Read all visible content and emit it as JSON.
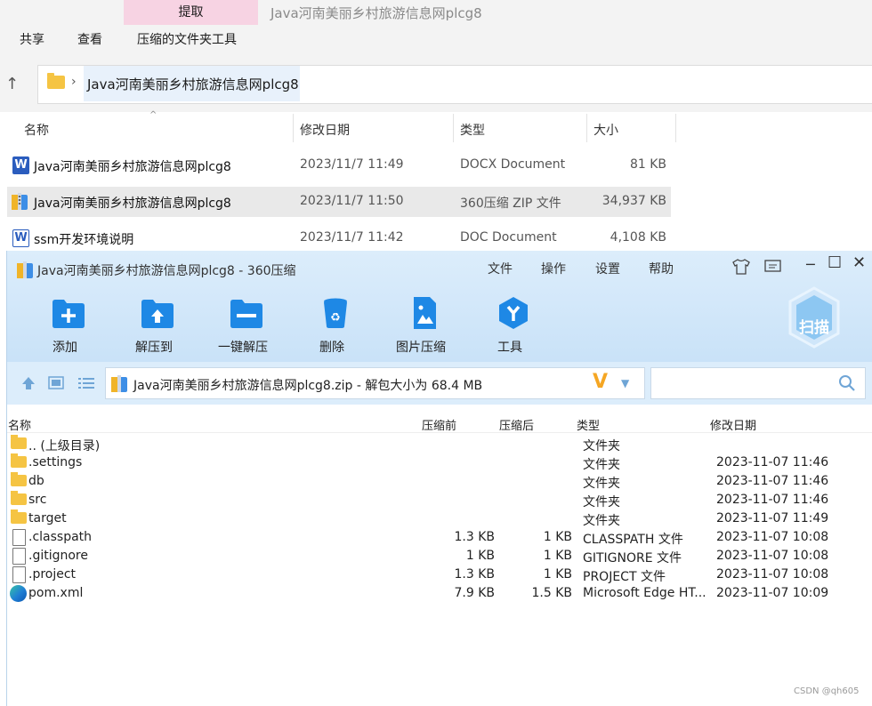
{
  "explorer": {
    "window_title": "Java河南美丽乡村旅游信息网plcg8",
    "ribbon": {
      "contextual_tab": "提取",
      "tabs": [
        "共享",
        "查看",
        "压缩的文件夹工具"
      ]
    },
    "address": {
      "crumb": "Java河南美丽乡村旅游信息网plcg8"
    },
    "columns": [
      "名称",
      "修改日期",
      "类型",
      "大小"
    ],
    "files": [
      {
        "name": "Java河南美丽乡村旅游信息网plcg8",
        "date": "2023/11/7 11:49",
        "type": "DOCX Document",
        "size": "81 KB",
        "icon": "word-docx-icon"
      },
      {
        "name": "Java河南美丽乡村旅游信息网plcg8",
        "date": "2023/11/7 11:50",
        "type": "360压缩 ZIP 文件",
        "size": "34,937 KB",
        "icon": "zip-archive-icon"
      },
      {
        "name": "ssm开发环境说明",
        "date": "2023/11/7 11:42",
        "type": "DOC Document",
        "size": "4,108 KB",
        "icon": "word-doc-icon"
      }
    ]
  },
  "zip": {
    "title": "Java河南美丽乡村旅游信息网plcg8 - 360压缩",
    "menu": [
      "文件",
      "操作",
      "设置",
      "帮助"
    ],
    "toolbar": [
      "添加",
      "解压到",
      "一键解压",
      "删除",
      "图片压缩",
      "工具"
    ],
    "scan_label": "扫描",
    "path": "Java河南美丽乡村旅游信息网plcg8.zip - 解包大小为 68.4 MB",
    "columns": [
      "名称",
      "压缩前",
      "压缩后",
      "类型",
      "修改日期"
    ],
    "rows": [
      {
        "name": ".. (上级目录)",
        "before": "",
        "after": "",
        "type": "文件夹",
        "date": "",
        "icon": "folder"
      },
      {
        "name": ".settings",
        "before": "",
        "after": "",
        "type": "文件夹",
        "date": "2023-11-07 11:46",
        "icon": "folder"
      },
      {
        "name": "db",
        "before": "",
        "after": "",
        "type": "文件夹",
        "date": "2023-11-07 11:46",
        "icon": "folder"
      },
      {
        "name": "src",
        "before": "",
        "after": "",
        "type": "文件夹",
        "date": "2023-11-07 11:46",
        "icon": "folder"
      },
      {
        "name": "target",
        "before": "",
        "after": "",
        "type": "文件夹",
        "date": "2023-11-07 11:49",
        "icon": "folder"
      },
      {
        "name": ".classpath",
        "before": "1.3 KB",
        "after": "1 KB",
        "type": "CLASSPATH 文件",
        "date": "2023-11-07 10:08",
        "icon": "file"
      },
      {
        "name": ".gitignore",
        "before": "1 KB",
        "after": "1 KB",
        "type": "GITIGNORE 文件",
        "date": "2023-11-07 10:08",
        "icon": "file"
      },
      {
        "name": ".project",
        "before": "1.3 KB",
        "after": "1 KB",
        "type": "PROJECT 文件",
        "date": "2023-11-07 10:08",
        "icon": "file"
      },
      {
        "name": "pom.xml",
        "before": "7.9 KB",
        "after": "1.5 KB",
        "type": "Microsoft Edge HT...",
        "date": "2023-11-07 10:09",
        "icon": "edge"
      }
    ]
  },
  "watermark": "CSDN @qh605",
  "colors": {
    "ribbon_highlight": "#f7d3e3",
    "zip_header": "#dcedfb",
    "toolbar_icon_blue": "#1e88e5",
    "folder_yellow": "#f5c443"
  }
}
